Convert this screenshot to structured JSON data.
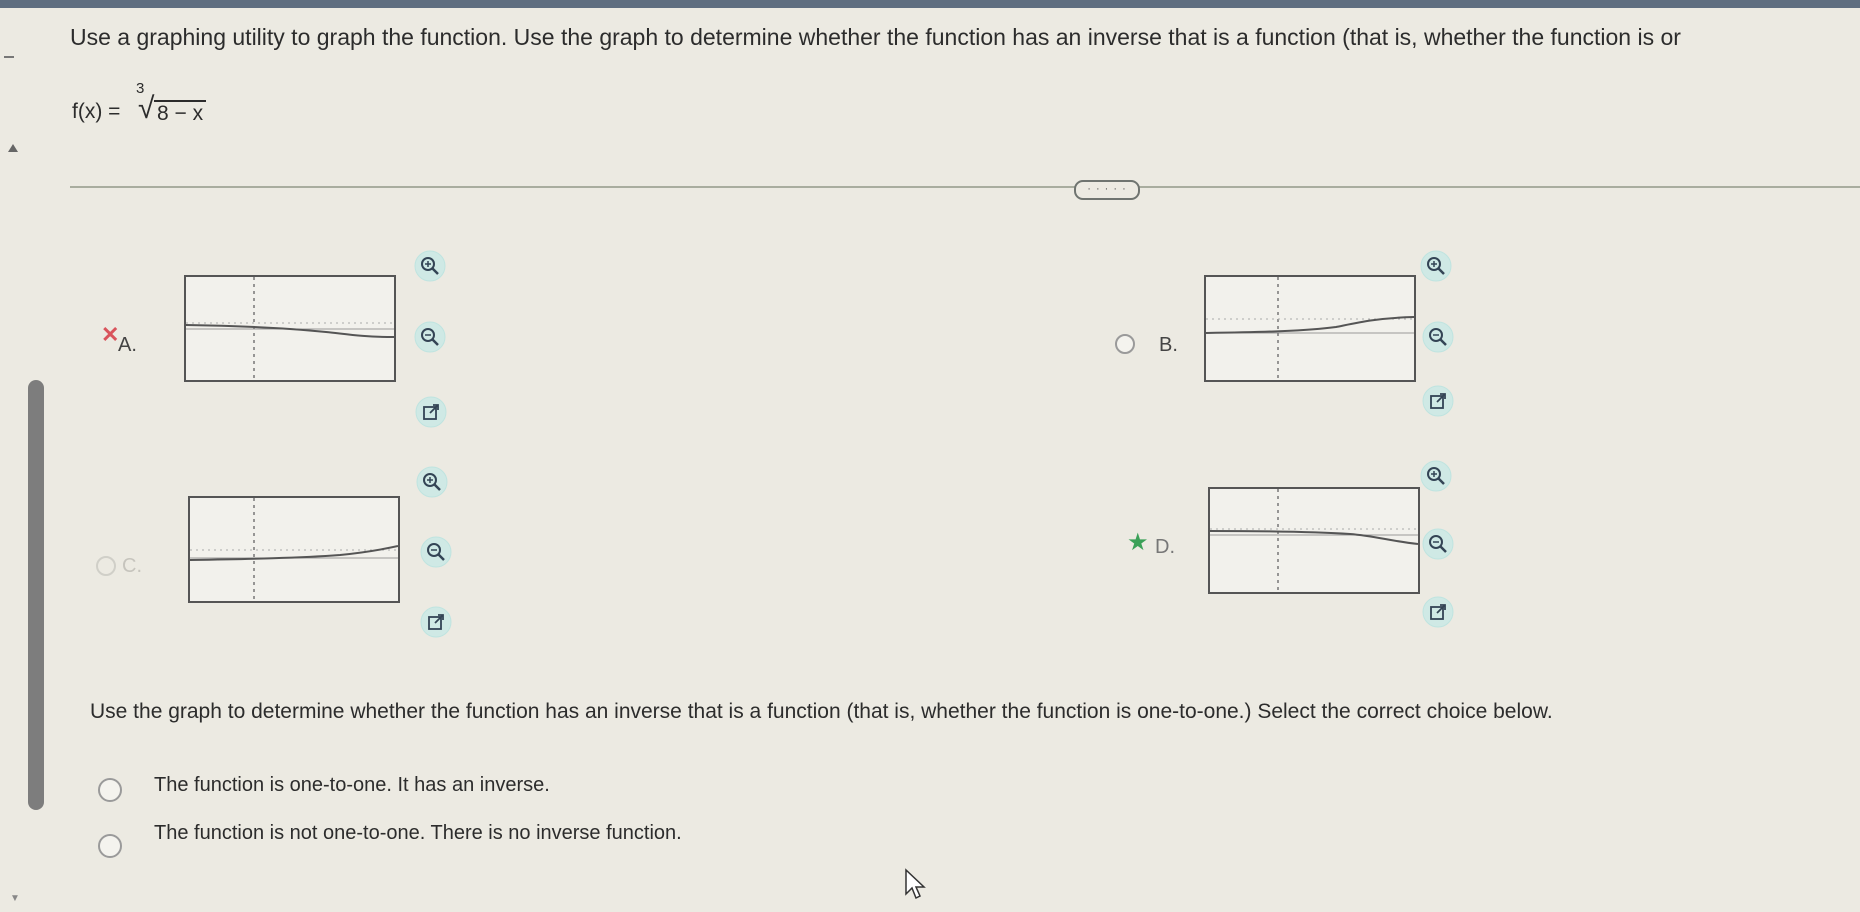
{
  "prompt": "Use a graphing utility to graph the function. Use the graph to determine whether the function has an inverse that is a function (that is, whether the function is or",
  "formula": {
    "lhs": "f(x) =",
    "index": "3",
    "radicand": "8 − x"
  },
  "more_button": "· · · · ·",
  "choices": [
    {
      "letter": "A.",
      "status": "incorrect"
    },
    {
      "letter": "B.",
      "status": "unselected"
    },
    {
      "letter": "C.",
      "status": "unselected"
    },
    {
      "letter": "D.",
      "status": "correct"
    }
  ],
  "question": "Use the graph to determine whether the function has an inverse that is a function (that is, whether the function is one-to-one.) Select the correct choice below.",
  "answers": [
    "The function is one-to-one. It has an inverse.",
    "The function is not one-to-one. There is no inverse function."
  ],
  "colors": {
    "incorrect": "#d9545c",
    "correct": "#3ba158",
    "icon_ring": "#bfe4e0",
    "icon_stroke": "#345"
  },
  "icons": [
    "zoom-in-icon",
    "zoom-out-icon",
    "open-new-window-icon",
    "incorrect-x-icon",
    "correct-star-icon",
    "mouse-cursor-icon"
  ]
}
